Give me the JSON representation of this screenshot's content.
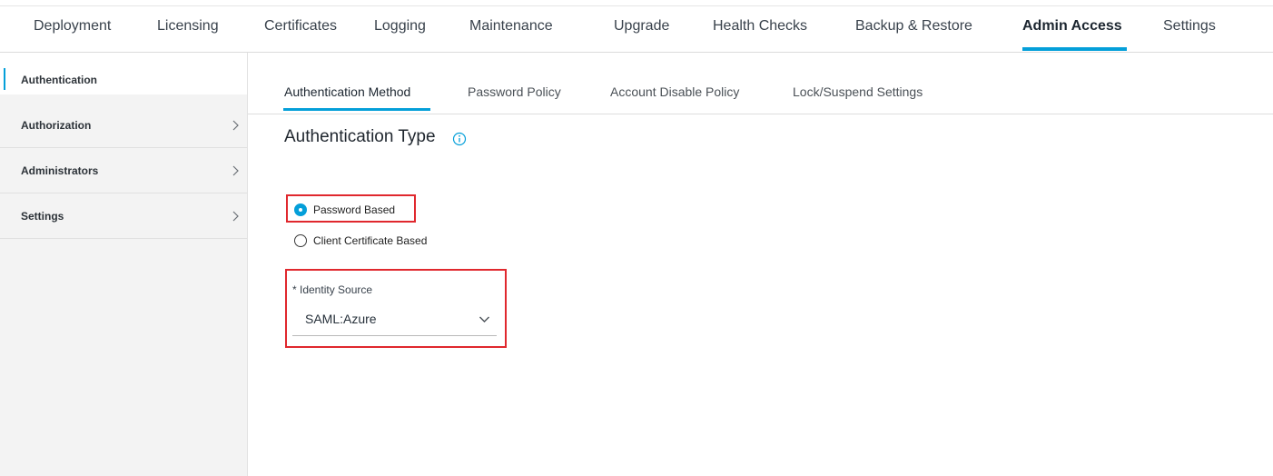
{
  "top_nav": {
    "items": [
      {
        "label": "Deployment"
      },
      {
        "label": "Licensing"
      },
      {
        "label": "Certificates"
      },
      {
        "label": "Logging"
      },
      {
        "label": "Maintenance"
      },
      {
        "label": "Upgrade"
      },
      {
        "label": "Health Checks"
      },
      {
        "label": "Backup & Restore"
      },
      {
        "label": "Admin Access"
      },
      {
        "label": "Settings"
      }
    ],
    "active": "Admin Access"
  },
  "sidebar": {
    "items": [
      {
        "label": "Authentication",
        "icon": null
      },
      {
        "label": "Authorization",
        "icon": "chevron-right-icon"
      },
      {
        "label": "Administrators",
        "icon": "chevron-right-icon"
      },
      {
        "label": "Settings",
        "icon": "chevron-right-icon"
      }
    ],
    "active": "Authentication"
  },
  "sub_tabs": {
    "items": [
      {
        "label": "Authentication Method"
      },
      {
        "label": "Password Policy"
      },
      {
        "label": "Account Disable Policy"
      },
      {
        "label": "Lock/Suspend Settings"
      }
    ],
    "active": "Authentication Method"
  },
  "content": {
    "title": "Authentication Type",
    "title_icon": "info-icon",
    "radio_options": [
      {
        "label": "Password Based",
        "selected": true
      },
      {
        "label": "Client Certificate Based",
        "selected": false
      }
    ],
    "identity_source": {
      "label": "* Identity Source",
      "value": "SAML:Azure",
      "icon": "chevron-down-icon"
    }
  },
  "colors": {
    "accent": "#049fd9",
    "highlight": "#e0282e",
    "sidebar_bg": "#f3f3f3"
  }
}
